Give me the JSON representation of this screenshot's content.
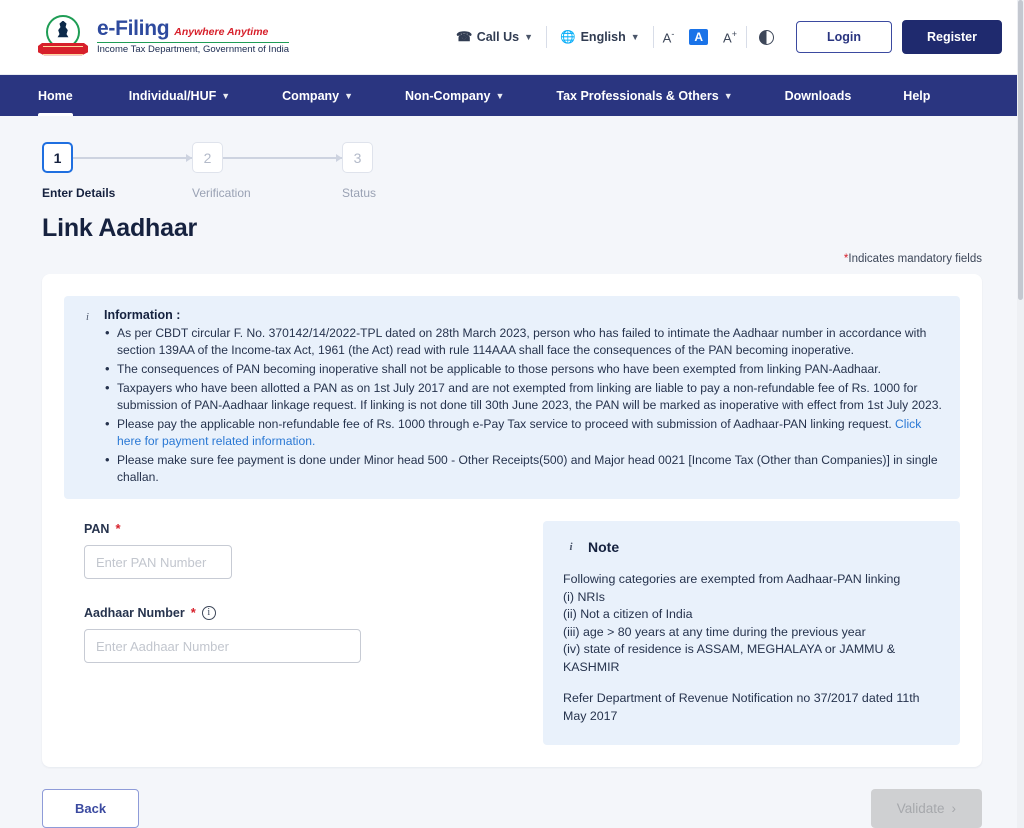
{
  "header": {
    "brand": {
      "efiling": "e-Filing",
      "tagline": "Anywhere Anytime",
      "department": "Income Tax Department, Government of India",
      "emblem_icon": "india-emblem-icon"
    },
    "call_us": "Call Us",
    "language": "English",
    "font_decrease": "A",
    "font_normal": "A",
    "font_increase": "A",
    "contrast_icon": "contrast-icon",
    "login": "Login",
    "register": "Register"
  },
  "nav": {
    "items": [
      {
        "label": "Home",
        "has_caret": false,
        "active": true
      },
      {
        "label": "Individual/HUF",
        "has_caret": true,
        "active": false
      },
      {
        "label": "Company",
        "has_caret": true,
        "active": false
      },
      {
        "label": "Non-Company",
        "has_caret": true,
        "active": false
      },
      {
        "label": "Tax Professionals & Others",
        "has_caret": true,
        "active": false
      },
      {
        "label": "Downloads",
        "has_caret": false,
        "active": false
      },
      {
        "label": "Help",
        "has_caret": false,
        "active": false
      }
    ]
  },
  "stepper": {
    "steps": [
      {
        "number": "1",
        "label": "Enter Details",
        "state": "current"
      },
      {
        "number": "2",
        "label": "Verification",
        "state": "todo"
      },
      {
        "number": "3",
        "label": "Status",
        "state": "todo"
      }
    ]
  },
  "page": {
    "title": "Link Aadhaar",
    "mandatory_star": "*",
    "mandatory_text": "Indicates mandatory fields"
  },
  "information": {
    "icon": "info-icon",
    "title": "Information :",
    "bullets": [
      "As per CBDT circular F. No. 370142/14/2022-TPL dated on 28th March 2023, person who has failed to intimate the Aadhaar number in accordance with section 139AA of the Income-tax Act, 1961 (the Act) read with rule 114AAA shall face the consequences of the PAN becoming inoperative.",
      "The consequences of PAN becoming inoperative shall not be applicable to those persons who have been exempted from linking PAN-Aadhaar.",
      "Taxpayers who have been allotted a PAN as on 1st July 2017 and are not exempted from linking are liable to pay a non-refundable fee of Rs. 1000 for submission of PAN-Aadhaar linkage request. If linking is not done till 30th June 2023, the PAN will be marked as inoperative with effect from 1st July 2023.",
      "Please make sure fee payment is done under Minor head 500 - Other Receipts(500) and Major head 0021 [Income Tax (Other than Companies)] in single challan."
    ],
    "bullet_with_link": {
      "text_before": "Please pay the applicable non-refundable fee of Rs. 1000 through e-Pay Tax service to proceed with submission of Aadhaar-PAN linking request. ",
      "link_text": "Click here for payment related information."
    }
  },
  "form": {
    "pan": {
      "label": "PAN",
      "required_star": "*",
      "placeholder": "Enter PAN Number",
      "value": ""
    },
    "aadhaar": {
      "label": "Aadhaar Number",
      "required_star": "*",
      "info_icon": "info-icon",
      "placeholder": "Enter Aadhaar Number",
      "value": ""
    }
  },
  "note": {
    "icon": "info-icon",
    "title": "Note",
    "intro": "Following categories are exempted from Aadhaar-PAN linking",
    "items": [
      "(i) NRIs",
      "(ii) Not a citizen of India",
      "(iii) age > 80 years at any time during the previous year",
      "(iv) state of residence is ASSAM, MEGHALAYA or JAMMU & KASHMIR"
    ],
    "reference": "Refer Department of Revenue Notification no 37/2017 dated 11th May 2017"
  },
  "footer": {
    "back": "Back",
    "validate": "Validate",
    "validate_caret": "›"
  },
  "colors": {
    "nav_navy": "#2a3580",
    "register_navy": "#1f2a6e",
    "info_blue_bg": "#e9f1fb",
    "link_blue": "#2a78d4",
    "required_red": "#d7202b",
    "active_step_blue": "#1f6fe0",
    "page_bg": "#f4f6fa"
  }
}
